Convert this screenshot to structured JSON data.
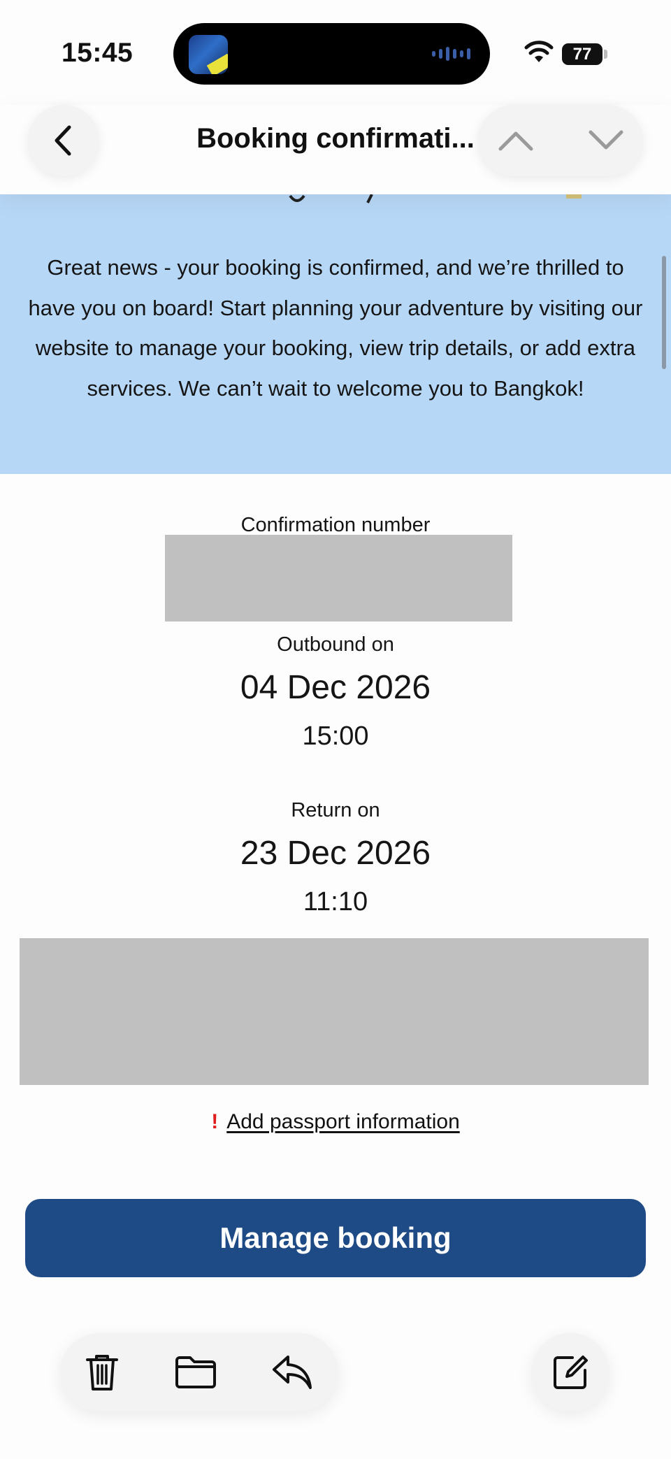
{
  "status_bar": {
    "time": "15:45",
    "battery": "77"
  },
  "header": {
    "title": "Booking confirmati..."
  },
  "message": {
    "body": "Great news - your booking is confirmed, and we’re thrilled to have you on board! Start planning your adventure by visiting our website to manage your booking, view trip details, or add extra services. We can’t wait to welcome you to Bangkok!"
  },
  "booking": {
    "confirmation_label": "Confirmation number",
    "outbound_label": "Outbound on",
    "outbound_date": "04 Dec 2026",
    "outbound_time": "15:00",
    "return_label": "Return on",
    "return_date": "23 Dec 2026",
    "return_time": "11:10"
  },
  "passport": {
    "icon": "!",
    "link": "Add passport information"
  },
  "actions": {
    "manage": "Manage booking"
  },
  "toolbar": {
    "icons": [
      "trash-icon",
      "folder-icon",
      "reply-icon",
      "compose-icon"
    ]
  },
  "colors": {
    "accent": "#1e4a86",
    "panel": "#b7d7f6",
    "alert": "#e01e1e"
  }
}
